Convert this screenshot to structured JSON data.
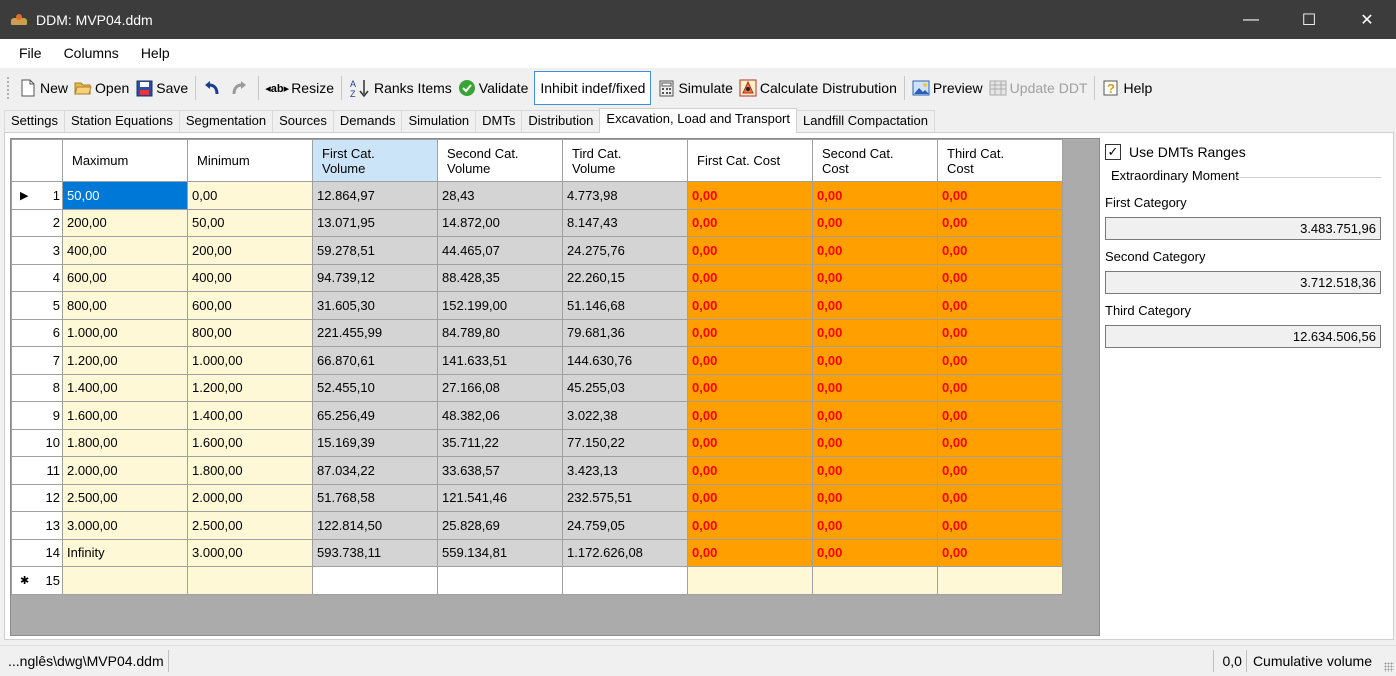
{
  "window": {
    "title": "DDM: MVP04.ddm",
    "minimize": "—",
    "maximize": "☐",
    "close": "✕"
  },
  "menu": [
    "File",
    "Columns",
    "Help"
  ],
  "toolbar": {
    "new": "New",
    "open": "Open",
    "save": "Save",
    "resize": "Resize",
    "ranks": "Ranks Items",
    "validate": "Validate",
    "inhibit": "Inhibit indef/fixed",
    "simulate": "Simulate",
    "calculate": "Calculate Distrubution",
    "preview": "Preview",
    "update": "Update DDT",
    "help": "Help"
  },
  "tabs": [
    "Settings",
    "Station Equations",
    "Segmentation",
    "Sources",
    "Demands",
    "Simulation",
    "DMTs",
    "Distribution",
    "Excavation, Load and Transport",
    "Landfill Compactation"
  ],
  "active_tab": "Excavation, Load and Transport",
  "grid": {
    "headers": [
      [
        "Maximum"
      ],
      [
        "Minimum"
      ],
      [
        "First Cat.",
        "Volume"
      ],
      [
        "Second Cat.",
        "Volume"
      ],
      [
        "Tird Cat.",
        "Volume"
      ],
      [
        "First Cat. Cost"
      ],
      [
        "Second Cat.",
        "Cost"
      ],
      [
        "Third Cat.",
        "Cost"
      ]
    ],
    "rows": [
      [
        "1",
        "50,00",
        "0,00",
        "12.864,97",
        "28,43",
        "4.773,98",
        "0,00",
        "0,00",
        "0,00"
      ],
      [
        "2",
        "200,00",
        "50,00",
        "13.071,95",
        "14.872,00",
        "8.147,43",
        "0,00",
        "0,00",
        "0,00"
      ],
      [
        "3",
        "400,00",
        "200,00",
        "59.278,51",
        "44.465,07",
        "24.275,76",
        "0,00",
        "0,00",
        "0,00"
      ],
      [
        "4",
        "600,00",
        "400,00",
        "94.739,12",
        "88.428,35",
        "22.260,15",
        "0,00",
        "0,00",
        "0,00"
      ],
      [
        "5",
        "800,00",
        "600,00",
        "31.605,30",
        "152.199,00",
        "51.146,68",
        "0,00",
        "0,00",
        "0,00"
      ],
      [
        "6",
        "1.000,00",
        "800,00",
        "221.455,99",
        "84.789,80",
        "79.681,36",
        "0,00",
        "0,00",
        "0,00"
      ],
      [
        "7",
        "1.200,00",
        "1.000,00",
        "66.870,61",
        "141.633,51",
        "144.630,76",
        "0,00",
        "0,00",
        "0,00"
      ],
      [
        "8",
        "1.400,00",
        "1.200,00",
        "52.455,10",
        "27.166,08",
        "45.255,03",
        "0,00",
        "0,00",
        "0,00"
      ],
      [
        "9",
        "1.600,00",
        "1.400,00",
        "65.256,49",
        "48.382,06",
        "3.022,38",
        "0,00",
        "0,00",
        "0,00"
      ],
      [
        "10",
        "1.800,00",
        "1.600,00",
        "15.169,39",
        "35.711,22",
        "77.150,22",
        "0,00",
        "0,00",
        "0,00"
      ],
      [
        "11",
        "2.000,00",
        "1.800,00",
        "87.034,22",
        "33.638,57",
        "3.423,13",
        "0,00",
        "0,00",
        "0,00"
      ],
      [
        "12",
        "2.500,00",
        "2.000,00",
        "51.768,58",
        "121.541,46",
        "232.575,51",
        "0,00",
        "0,00",
        "0,00"
      ],
      [
        "13",
        "3.000,00",
        "2.500,00",
        "122.814,50",
        "25.828,69",
        "24.759,05",
        "0,00",
        "0,00",
        "0,00"
      ],
      [
        "14",
        "Infinity",
        "3.000,00",
        "593.738,11",
        "559.134,81",
        "1.172.626,08",
        "0,00",
        "0,00",
        "0,00"
      ]
    ],
    "new_row_number": "15",
    "new_row_marker": "✱",
    "current_row_marker": "▶",
    "colors": {
      "yellow": "#fff8d6",
      "gray": "#d4d4d4",
      "orange": "#ffa000",
      "red_text": "#ff0000",
      "selected": "#0078d7"
    }
  },
  "right_panel": {
    "use_dmts_ranges": "Use DMTs Ranges",
    "checked": true,
    "group_title": "Extraordinary Moment",
    "fields": [
      {
        "label": "First Category",
        "value": "3.483.751,96"
      },
      {
        "label": "Second Category",
        "value": "3.712.518,36"
      },
      {
        "label": "Third Category",
        "value": "12.634.506,56"
      }
    ]
  },
  "status": {
    "path": "...nglês\\dwg\\MVP04.ddm",
    "value": "0,0",
    "mode": "Cumulative volume"
  }
}
